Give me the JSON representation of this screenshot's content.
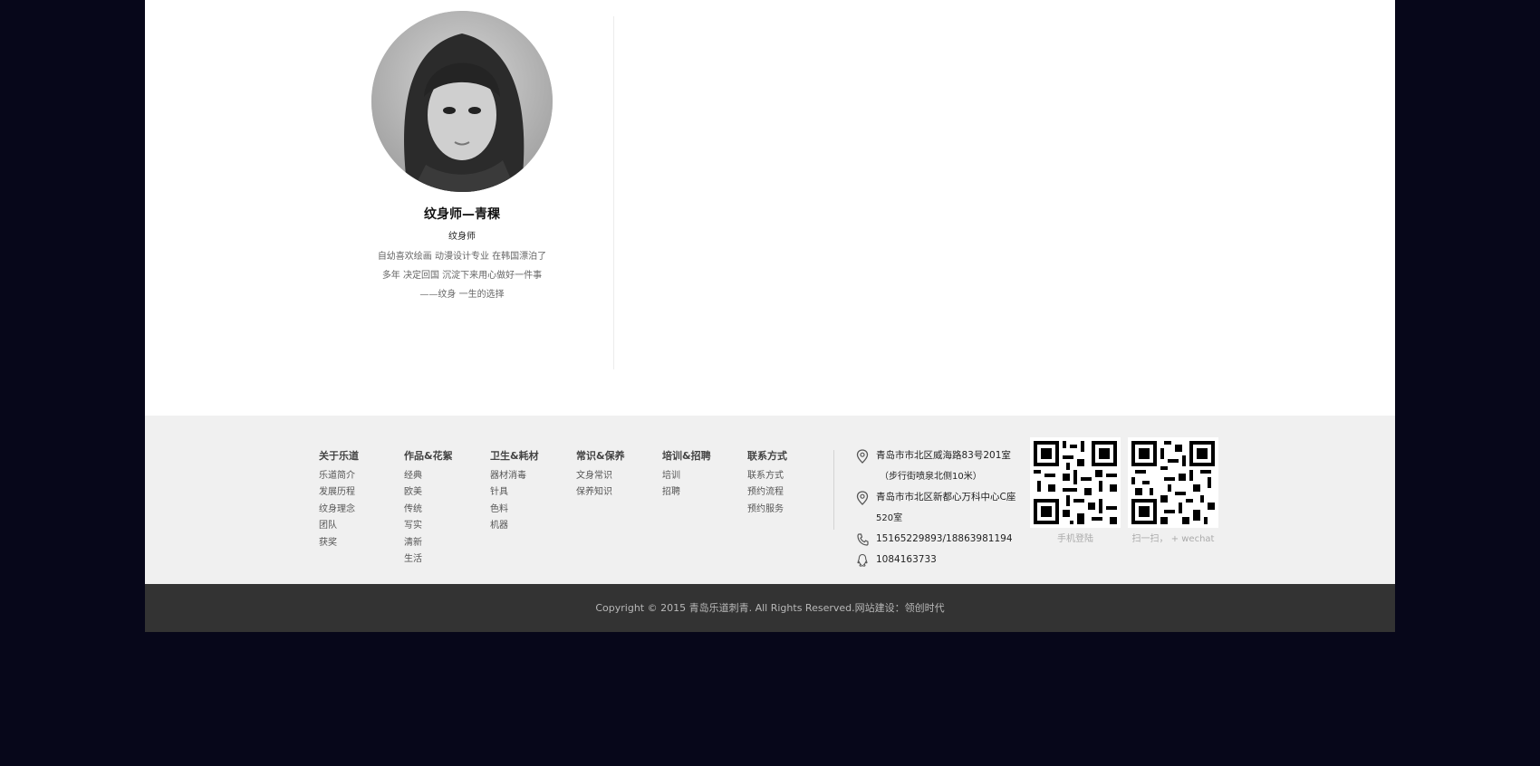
{
  "profile": {
    "name": "纹身师—青稞",
    "role": "纹身师",
    "description": "自幼喜欢绘画 动漫设计专业 在韩国漂泊了多年 决定回国 沉淀下来用心做好一件事——纹身 一生的选择"
  },
  "footer": {
    "columns": [
      {
        "title": "关于乐道",
        "links": [
          "乐道简介",
          "发展历程",
          "纹身理念",
          "团队",
          "获奖"
        ]
      },
      {
        "title": "作品&花絮",
        "links": [
          "经典",
          "欧美",
          "传统",
          "写实",
          "清新",
          "生活"
        ]
      },
      {
        "title": "卫生&耗材",
        "links": [
          "器材消毒",
          "针具",
          "色料",
          "机器"
        ]
      },
      {
        "title": "常识&保养",
        "links": [
          "文身常识",
          "保养知识"
        ]
      },
      {
        "title": "培训&招聘",
        "links": [
          "培训",
          "招聘"
        ]
      },
      {
        "title": "联系方式",
        "links": [
          "联系方式",
          "预约流程",
          "预约服务"
        ]
      }
    ],
    "contacts": {
      "address1": "青岛市市北区威海路83号201室",
      "address1_note": "（步行街喷泉北侧10米）",
      "address2": "青岛市市北区新都心万科中心C座",
      "address2_note": "520室",
      "phone": "15165229893/18863981194",
      "qq": "1084163733"
    },
    "qr": [
      {
        "caption": "手机登陆"
      },
      {
        "caption": "扫一扫， + wechat"
      }
    ]
  },
  "copyright": "Copyright © 2015 青岛乐道刺青. All Rights Reserved.网站建设：领创时代"
}
